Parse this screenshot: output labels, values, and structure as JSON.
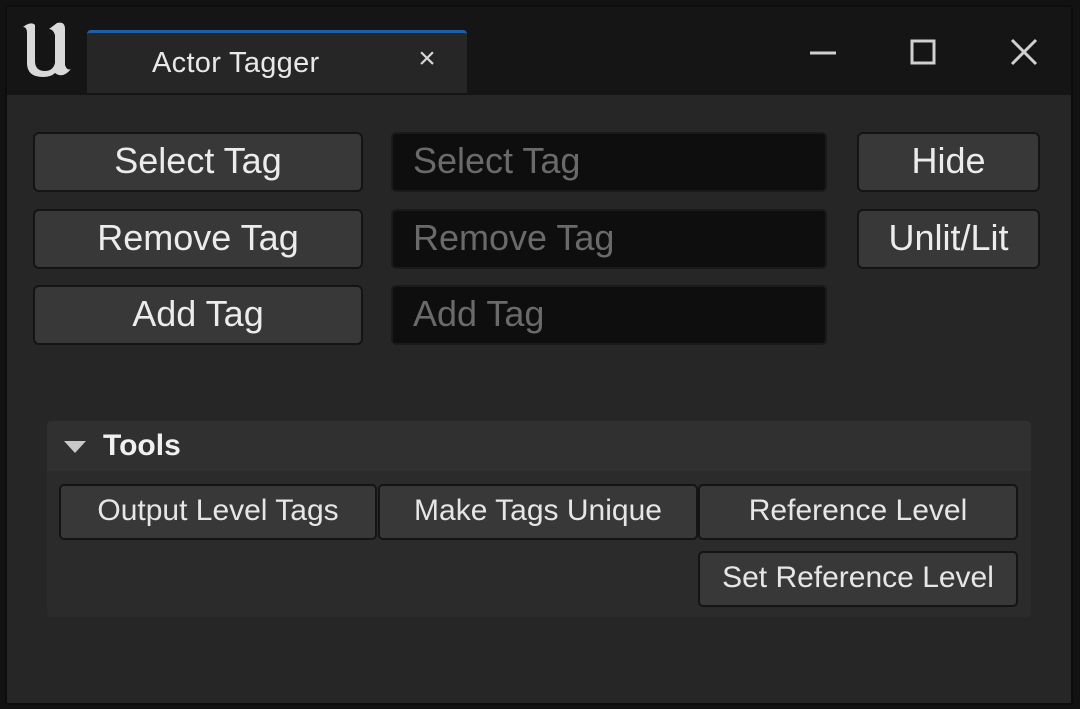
{
  "window": {
    "tab_title": "Actor Tagger",
    "tab_close": "×"
  },
  "rows": [
    {
      "button": "Select Tag",
      "placeholder": "Select Tag",
      "value": ""
    },
    {
      "button": "Remove Tag",
      "placeholder": "Remove Tag",
      "value": ""
    },
    {
      "button": "Add Tag",
      "placeholder": "Add Tag",
      "value": ""
    }
  ],
  "side_buttons": {
    "hide": "Hide",
    "unlit_lit": "Unlit/Lit"
  },
  "tools": {
    "title": "Tools",
    "buttons": {
      "output_level_tags": "Output Level Tags",
      "make_tags_unique": "Make Tags Unique",
      "reference_level": "Reference Level",
      "set_reference_level": "Set Reference Level"
    }
  },
  "icons": {
    "logo": "unreal-engine-logo",
    "minimize": "minimize-icon",
    "maximize": "maximize-icon",
    "close": "close-icon",
    "collapse": "triangle-down-icon"
  },
  "colors": {
    "window_bg": "#262626",
    "titlebar_bg": "#151515",
    "tab_accent": "#1f5fa8",
    "button_bg": "#383838",
    "input_bg": "#0e0e0e",
    "placeholder_text": "#6a6a6a"
  }
}
